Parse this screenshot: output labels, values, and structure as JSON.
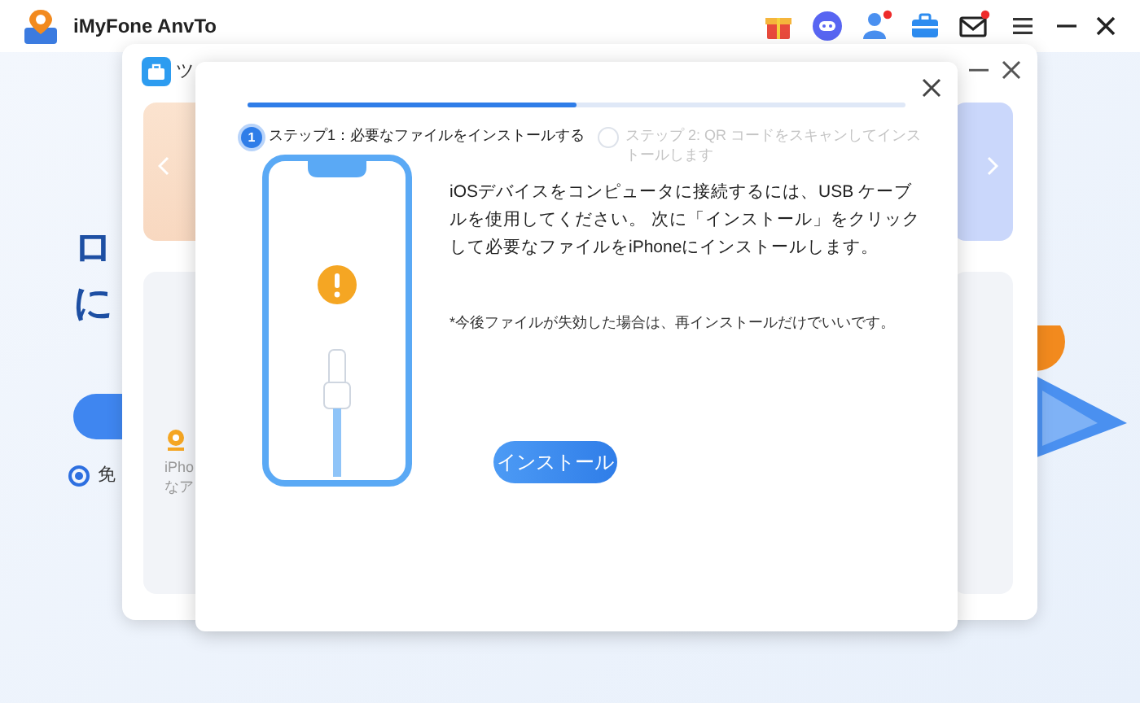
{
  "app": {
    "title": "iMyFone AnvTo",
    "toolbar": [
      {
        "kind": "gift",
        "badge": false
      },
      {
        "kind": "chat",
        "badge": false
      },
      {
        "kind": "user",
        "badge": true
      },
      {
        "kind": "toolbox",
        "badge": false
      },
      {
        "kind": "mail",
        "badge": true
      },
      {
        "kind": "menu",
        "badge": false
      }
    ]
  },
  "background_page": {
    "heading_lines": [
      "ロ",
      "に"
    ],
    "option": {
      "label": "免",
      "selected": true
    }
  },
  "tool_window": {
    "title": "ツ",
    "feature_card": {
      "text_lines": [
        "iPho",
        "なア"
      ]
    }
  },
  "dialog": {
    "progress": {
      "level": 0.5
    },
    "steps": [
      {
        "number": "1",
        "label": "ステップ1：必要なファイルをインストールする",
        "selected": true
      },
      {
        "label": "ステップ 2: QR コードをスキャンしてインストールします",
        "selected": false
      }
    ],
    "instructions": "iOSデバイスをコンピュータに接続するには、USB ケーブルを使用してください。 次に「インストール」をクリックして必要なファイルをiPhoneにインストールします。",
    "note": "*今後ファイルが失効した場合は、再インストールだけでいいです。",
    "install_button": "インストール"
  }
}
